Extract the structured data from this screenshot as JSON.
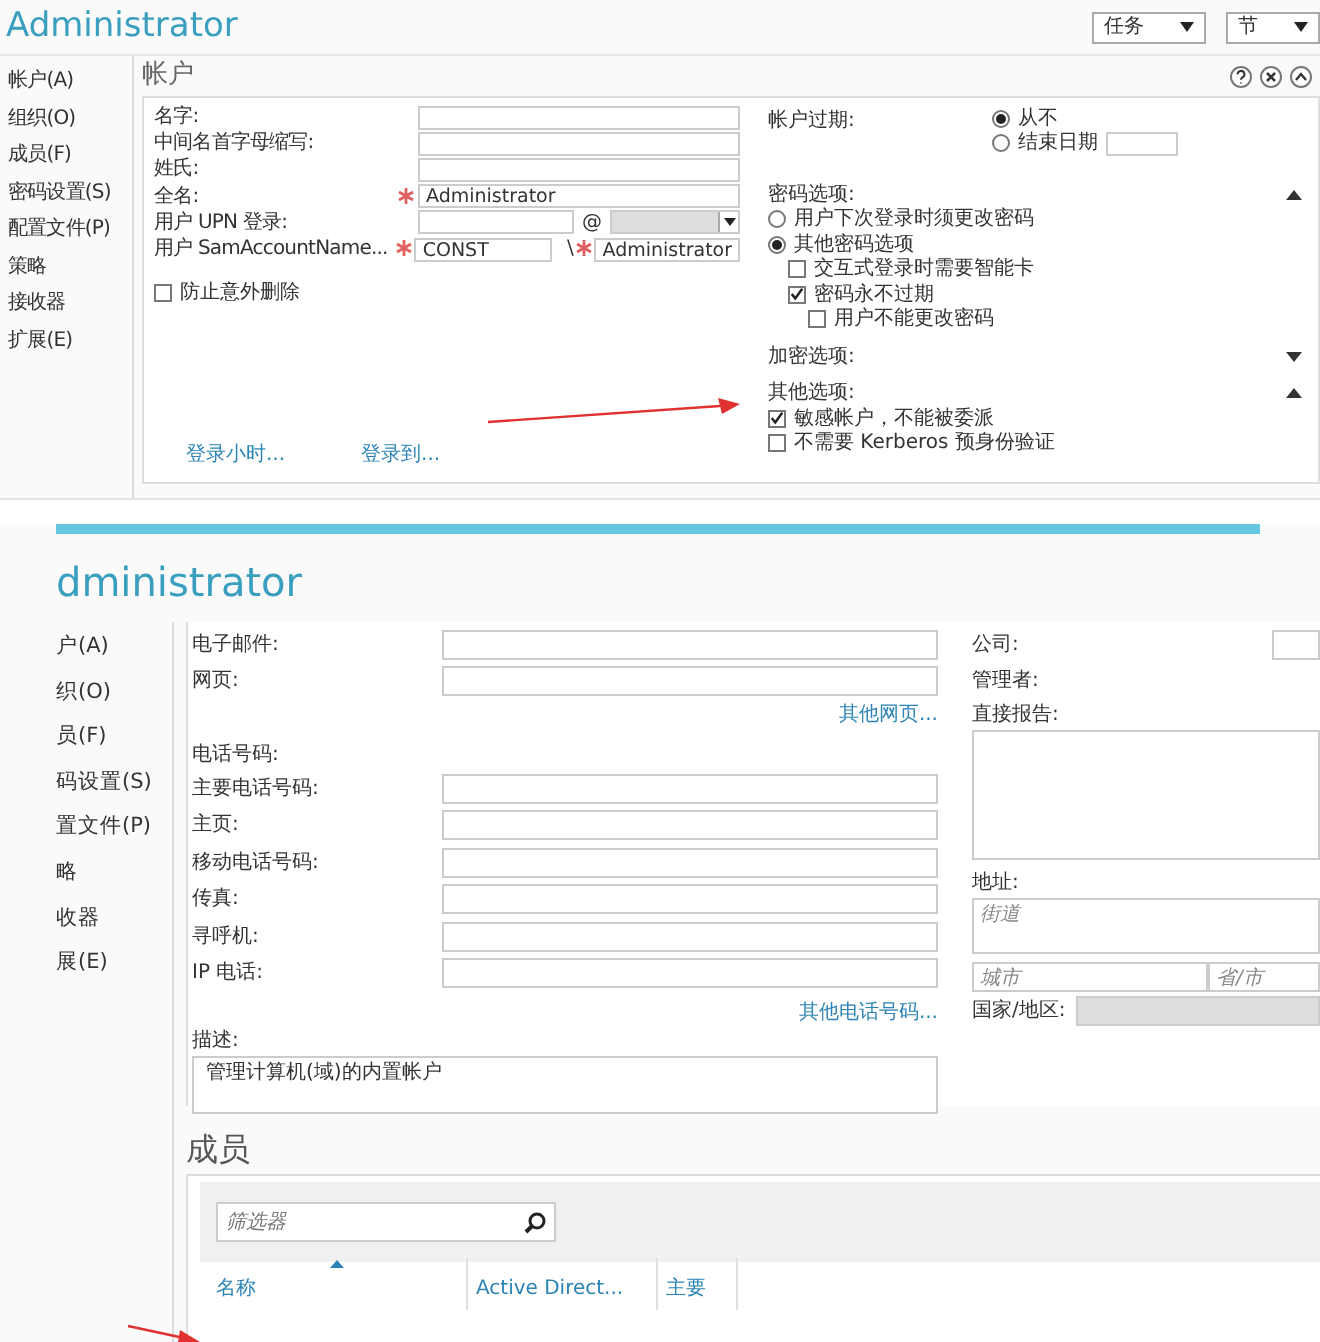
{
  "top_panel": {
    "title": "Administrator",
    "toolbar": [
      {
        "label": "任务",
        "kind": "dropdown"
      },
      {
        "label": "节",
        "kind": "dropdown"
      }
    ],
    "nav": [
      "帐户(A)",
      "组织(O)",
      "成员(F)",
      "密码设置(S)",
      "配置文件(P)",
      "策略",
      "接收器",
      "扩展(E)"
    ],
    "section_title": "帐户",
    "fields": [
      {
        "label": "名字:",
        "kind": "text",
        "required": false
      },
      {
        "label": "中间名首字母缩写:",
        "kind": "text",
        "required": false
      },
      {
        "label": "姓氏:",
        "kind": "text",
        "required": false
      },
      {
        "label": "全名:",
        "kind": "text",
        "required": true,
        "value": "Administrator"
      },
      {
        "label": "用户 UPN 登录:",
        "kind": "upn",
        "required": false,
        "suffix": "@"
      },
      {
        "label": "用户 SamAccountName...",
        "kind": "sam",
        "required": true,
        "value": "CONST",
        "separator": "\\",
        "value_2": "Administrator"
      }
    ],
    "protect": {
      "label": "防止意外删除",
      "checked": false
    },
    "links": [
      "登录小时...",
      "登录到..."
    ],
    "expiry": {
      "label": "帐户过期:",
      "options": [
        {
          "label": "从不",
          "selected": true
        },
        {
          "label": "结束日期",
          "selected": false
        }
      ]
    },
    "groups": [
      {
        "label": "密码选项:",
        "expanded": true,
        "options": [
          {
            "label": "用户下次登录时须更改密码",
            "selected": false
          },
          {
            "label": "其他密码选项",
            "selected": true
          }
        ],
        "checkboxes": [
          {
            "label": "交互式登录时需要智能卡",
            "checked": false
          },
          {
            "label": "密码永不过期",
            "checked": true,
            "children": [
              {
                "label": "用户不能更改密码",
                "checked": false
              }
            ]
          }
        ]
      },
      {
        "label": "加密选项:",
        "expanded": false
      },
      {
        "label": "其他选项:",
        "expanded": true,
        "checkboxes": [
          {
            "label": "敏感帐户，不能被委派",
            "checked": true
          },
          {
            "label": "不需要 Kerberos 预身份验证",
            "checked": false
          }
        ]
      }
    ]
  },
  "bottom_panel": {
    "title": "dministrator",
    "nav": [
      "户(A)",
      "织(O)",
      "员(F)",
      "码设置(S)",
      "置文件(P)",
      "略",
      "收器",
      "展(E)"
    ],
    "contact_fields": [
      "电子邮件:",
      "网页:"
    ],
    "web_link": "其他网页...",
    "phone_heading": "电话号码:",
    "phone_fields": [
      "主要电话号码:",
      "主页:",
      "移动电话号码:",
      "传真:",
      "寻呼机:",
      "IP 电话:"
    ],
    "phone_link": "其他电话号码...",
    "description": {
      "label": "描述:",
      "value": "管理计算机(域)的内置帐户"
    },
    "company_label": "公司:",
    "manager_label": "管理者:",
    "reports_label": "直接报告:",
    "address_label": "地址:",
    "street_placeholder": "街道",
    "city_placeholder": "城市",
    "state_placeholder": "省/市",
    "country_label": "国家/地区:",
    "members": {
      "title": "成员",
      "filter_placeholder": "筛选器",
      "columns": [
        {
          "label": "名称",
          "sorted": true
        },
        {
          "label": "Active Direct...",
          "sorted": false
        },
        {
          "label": "主要",
          "sorted": false
        }
      ]
    }
  }
}
